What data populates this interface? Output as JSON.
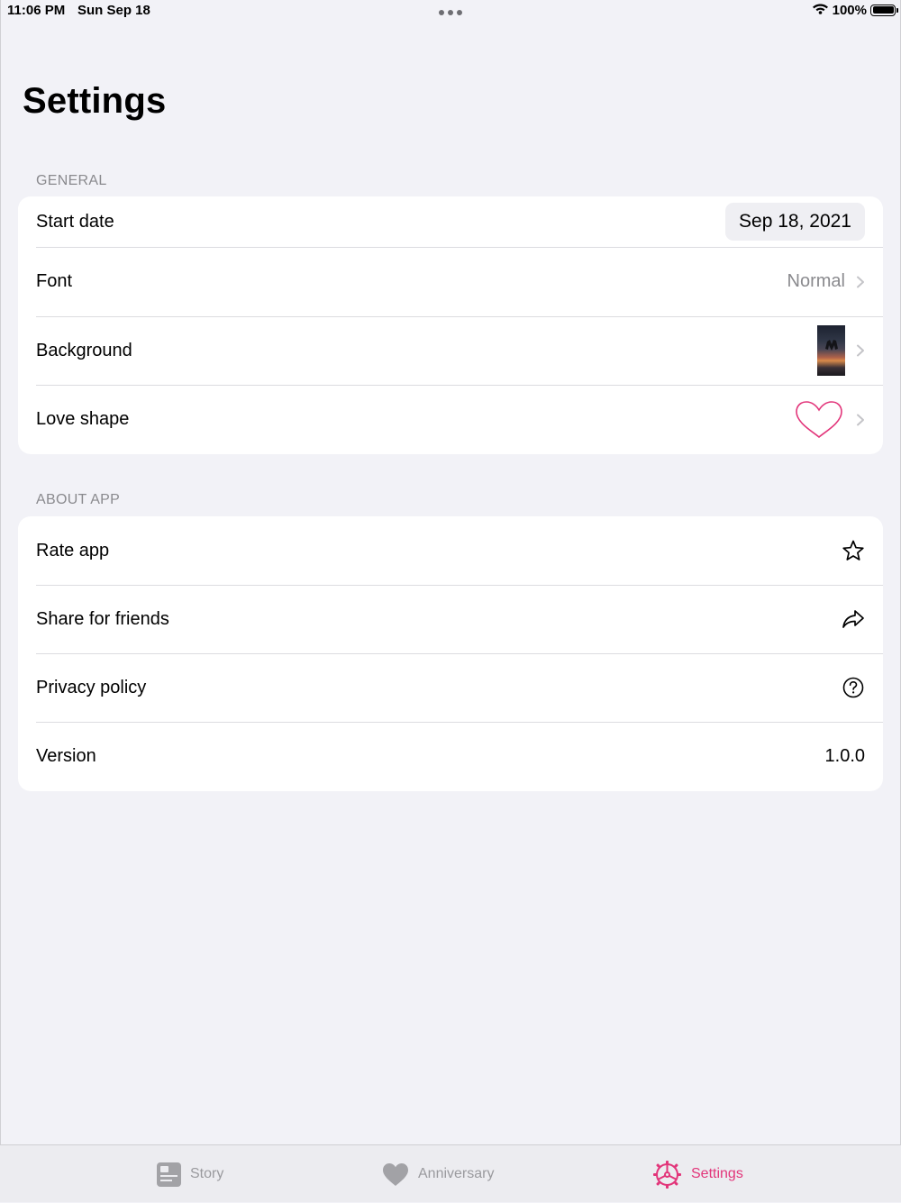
{
  "status_bar": {
    "time": "11:06 PM",
    "date": "Sun Sep 18",
    "battery": "100%"
  },
  "page_title": "Settings",
  "general": {
    "header": "GENERAL",
    "start_date": {
      "label": "Start date",
      "value": "Sep 18, 2021"
    },
    "font": {
      "label": "Font",
      "value": "Normal"
    },
    "background": {
      "label": "Background"
    },
    "love_shape": {
      "label": "Love shape"
    }
  },
  "about": {
    "header": "ABOUT APP",
    "rate": {
      "label": "Rate app"
    },
    "share": {
      "label": "Share for friends"
    },
    "privacy": {
      "label": "Privacy policy"
    },
    "version": {
      "label": "Version",
      "value": "1.0.0"
    }
  },
  "tabs": [
    {
      "label": "Story",
      "icon": "story-icon",
      "active": false
    },
    {
      "label": "Anniversary",
      "icon": "heart-icon",
      "active": false
    },
    {
      "label": "Settings",
      "icon": "settings-gear-icon",
      "active": true
    }
  ],
  "colors": {
    "background": "#f2f2f7",
    "accent": "#e2357a",
    "secondary_text": "#8a8a8e",
    "tab_inactive": "#9a9a9e"
  }
}
